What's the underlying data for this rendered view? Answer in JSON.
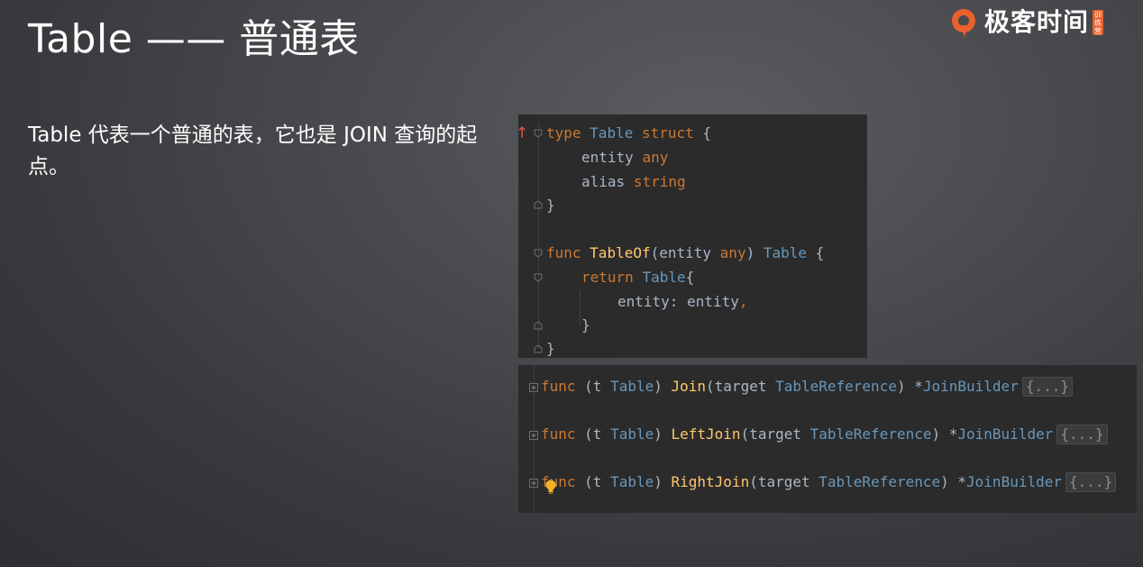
{
  "slide": {
    "title": "Table —— 普通表",
    "description": "Table 代表一个普通的表，它也是 JOIN 查询的起点。"
  },
  "logo": {
    "text": "极客时间",
    "badge": [
      "训",
      "练",
      "营"
    ],
    "brand_color": "#e8602c"
  },
  "struct_panel": {
    "line1": {
      "kw_type": "type",
      "name": "Table",
      "kw_struct": "struct",
      "brace": " {"
    },
    "line2": {
      "field": "entity",
      "type": "any"
    },
    "line3": {
      "field": "alias",
      "type": "string"
    },
    "line4": {
      "brace": "}"
    },
    "line6": {
      "kw_func": "func",
      "name": "TableOf",
      "params_open": "(entity ",
      "param_type": "any",
      "params_close": ") ",
      "ret_type": "Table",
      "brace": " {"
    },
    "line7": {
      "kw_return": "return",
      "type": "Table",
      "brace": "{"
    },
    "line8": {
      "text": "entity: entity",
      "comma": ","
    },
    "line9": {
      "brace": "}"
    },
    "line10": {
      "brace": "}"
    }
  },
  "methods_panel": {
    "methods": [
      {
        "kw": "func",
        "open": " (t ",
        "recv_type": "Table",
        "close": ") ",
        "name": "Join",
        "params_open": "(target ",
        "param_type": "TableReference",
        "params_close": ") ",
        "star": "*",
        "ret_type": "JoinBuilder",
        "folded": "{...}"
      },
      {
        "kw": "func",
        "open": " (t ",
        "recv_type": "Table",
        "close": ") ",
        "name": "LeftJoin",
        "params_open": "(target ",
        "param_type": "TableReference",
        "params_close": ") ",
        "star": "*",
        "ret_type": "JoinBuilder",
        "folded": "{...}"
      },
      {
        "kw": "func",
        "open": " (t ",
        "recv_type": "Table",
        "close": ") ",
        "name": "RightJoin",
        "params_open": "(target ",
        "param_type": "TableReference",
        "params_close": ") ",
        "star": "*",
        "ret_type": "JoinBuilder",
        "folded": "{...}"
      }
    ]
  },
  "colors": {
    "keyword": "#cc7832",
    "type": "#6897bb",
    "function": "#ffc66d",
    "text": "#a9b7c6",
    "editor_bg": "#2b2b2b",
    "bulb": "#f0b429"
  },
  "icons": {
    "arrow": "up-arrow-icon",
    "bulb": "lightbulb-icon",
    "fold": "fold-icon"
  }
}
